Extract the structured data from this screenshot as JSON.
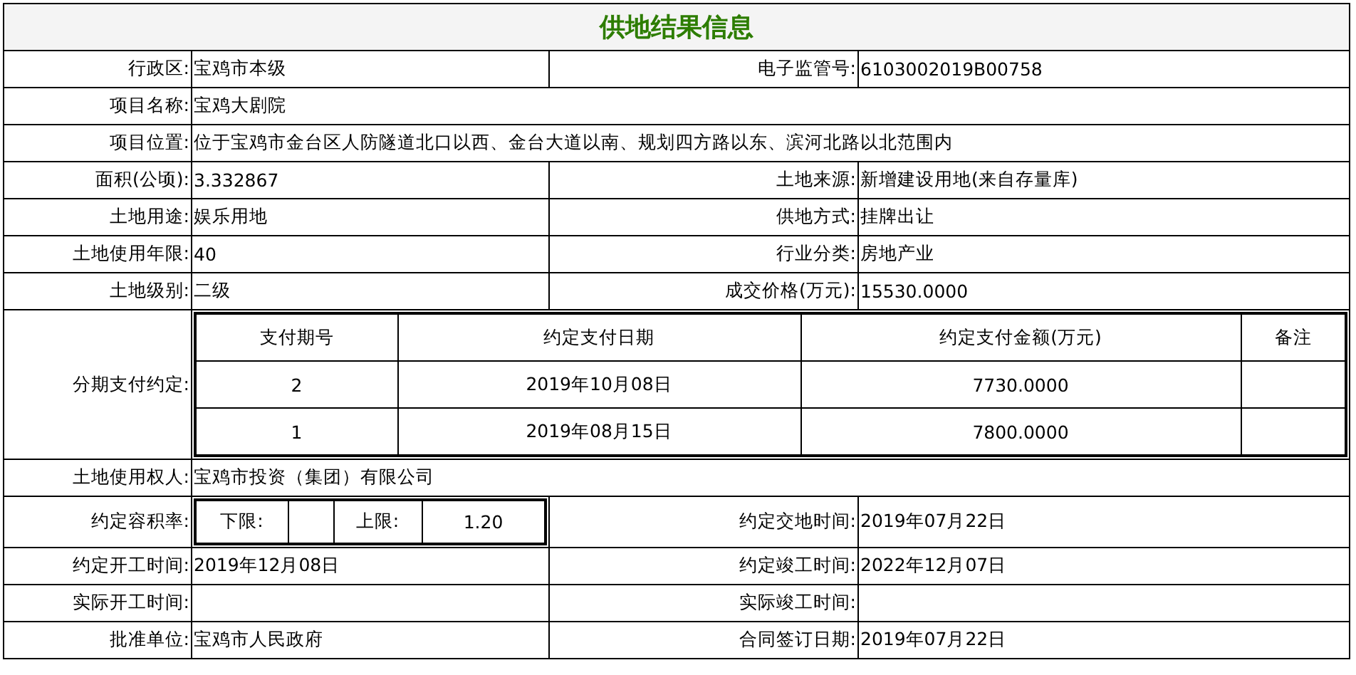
{
  "title": "供地结果信息",
  "rows": [
    {
      "kind": "pair",
      "left": {
        "label": "行政区:",
        "value": "宝鸡市本级"
      },
      "right": {
        "label": "电子监管号:",
        "value": "6103002019B00758"
      }
    },
    {
      "kind": "wide",
      "label": "项目名称:",
      "value": "宝鸡大剧院"
    },
    {
      "kind": "wide",
      "label": "项目位置:",
      "value": "位于宝鸡市金台区人防隧道北口以西、金台大道以南、规划四方路以东、滨河北路以北范围内"
    },
    {
      "kind": "pair",
      "left": {
        "label": "面积(公顷):",
        "value": "3.332867"
      },
      "right": {
        "label": "土地来源:",
        "value": "新增建设用地(来自存量库)"
      }
    },
    {
      "kind": "pair",
      "left": {
        "label": "土地用途:",
        "value": "娱乐用地"
      },
      "right": {
        "label": "供地方式:",
        "value": "挂牌出让"
      }
    },
    {
      "kind": "pair",
      "left": {
        "label": "土地使用年限:",
        "value": "40"
      },
      "right": {
        "label": "行业分类:",
        "value": "房地产业"
      }
    },
    {
      "kind": "pair",
      "left": {
        "label": "土地级别:",
        "value": "二级"
      },
      "right": {
        "label": "成交价格(万元):",
        "value": "15530.0000"
      }
    },
    {
      "kind": "installments",
      "label": "分期支付约定:",
      "columns": [
        "支付期号",
        "约定支付日期",
        "约定支付金额(万元)",
        "备注"
      ],
      "items": [
        {
          "period": "2",
          "date": "2019年10月08日",
          "amount": "7730.0000"
        },
        {
          "period": "1",
          "date": "2019年08月15日",
          "amount": "7800.0000"
        }
      ]
    },
    {
      "kind": "wide",
      "label": "土地使用权人:",
      "value": "宝鸡市投资（集团）有限公司"
    },
    {
      "kind": "far",
      "left": {
        "label": "约定容积率:",
        "lower_label": "下限:",
        "upper_label": "上限:",
        "upper_value": "1.20"
      },
      "right": {
        "label": "约定交地时间:",
        "value": "2019年07月22日"
      }
    },
    {
      "kind": "pair",
      "left": {
        "label": "约定开工时间:",
        "value": "2019年12月08日"
      },
      "right": {
        "label": "约定竣工时间:",
        "value": "2022年12月07日"
      }
    },
    {
      "kind": "pair",
      "left": {
        "label": "实际开工时间:"
      },
      "right": {
        "label": "实际竣工时间:"
      }
    },
    {
      "kind": "pair",
      "left": {
        "label": "批准单位:",
        "value": "宝鸡市人民政府"
      },
      "right": {
        "label": "合同签订日期:",
        "value": "2019年07月22日"
      }
    }
  ]
}
